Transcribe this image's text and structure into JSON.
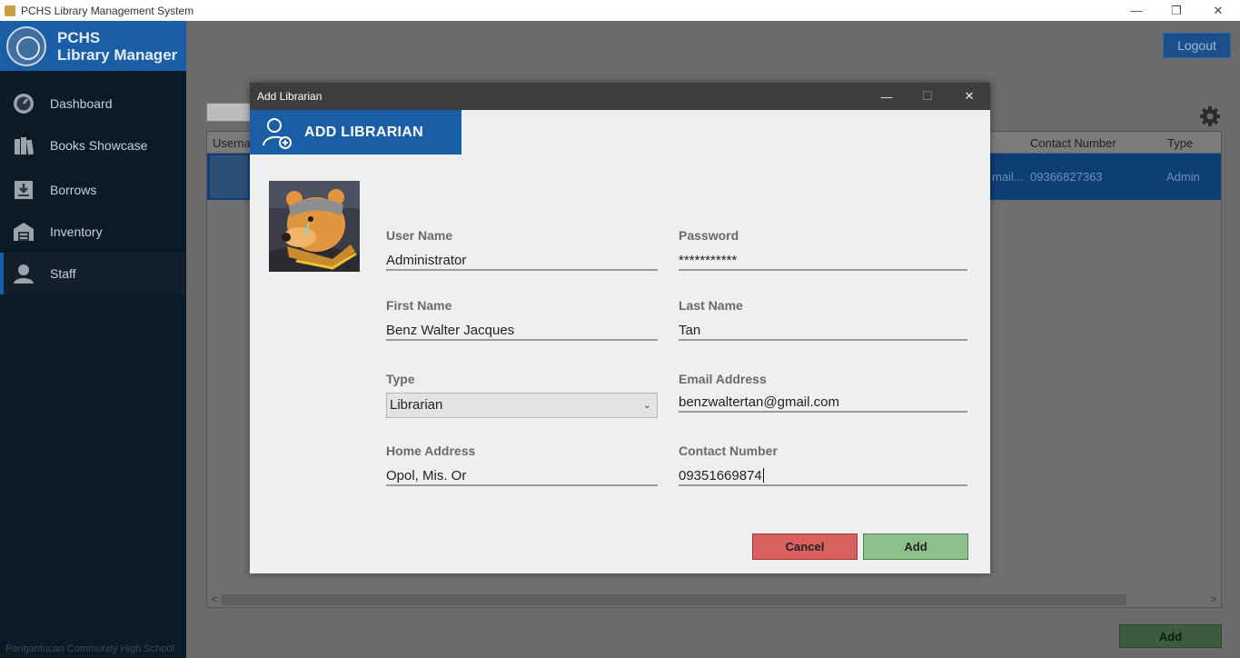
{
  "window": {
    "title": "PCHS Library Management System",
    "minimize": "—",
    "restore": "❐",
    "close": "✕"
  },
  "sidebar": {
    "brand_line1": "PCHS",
    "brand_line2": "Library Manager",
    "items": [
      {
        "label": "Dashboard",
        "icon": "dashboard-icon"
      },
      {
        "label": "Books Showcase",
        "icon": "books-icon"
      },
      {
        "label": "Borrows",
        "icon": "download-icon"
      },
      {
        "label": "Inventory",
        "icon": "warehouse-icon"
      },
      {
        "label": "Staff",
        "icon": "user-icon",
        "active": true
      }
    ],
    "footer": "Pangantucan Community High School"
  },
  "main": {
    "logout_label": "Logout",
    "add_label": "Add",
    "grid": {
      "headers": {
        "username": "Userna",
        "contact": "Contact Number",
        "type": "Type"
      },
      "row": {
        "email_partial": "mail...",
        "contact": "09366827363",
        "type": "Admin"
      },
      "scroll_left": "<",
      "scroll_right": ">"
    }
  },
  "dialog": {
    "title": "Add Librarian",
    "minimize": "—",
    "maximize": "☐",
    "close": "✕",
    "header": "ADD LIBRARIAN",
    "fields": {
      "username": {
        "label": "User Name",
        "value": "Administrator"
      },
      "password": {
        "label": "Password",
        "value": "***********"
      },
      "first_name": {
        "label": "First Name",
        "value": "Benz Walter Jacques"
      },
      "last_name": {
        "label": "Last Name",
        "value": "Tan"
      },
      "type": {
        "label": "Type",
        "value": "Librarian"
      },
      "email": {
        "label": "Email Address",
        "value": "benzwaltertan@gmail.com"
      },
      "home_address": {
        "label": "Home Address",
        "value": "Opol, Mis. Or"
      },
      "contact": {
        "label": "Contact Number",
        "value": "09351669874"
      }
    },
    "cancel_label": "Cancel",
    "add_label": "Add"
  },
  "colors": {
    "accent": "#1a5ea6",
    "sidebar": "#0a1a27",
    "cancel": "#d9605e",
    "add": "#8cc08a"
  }
}
